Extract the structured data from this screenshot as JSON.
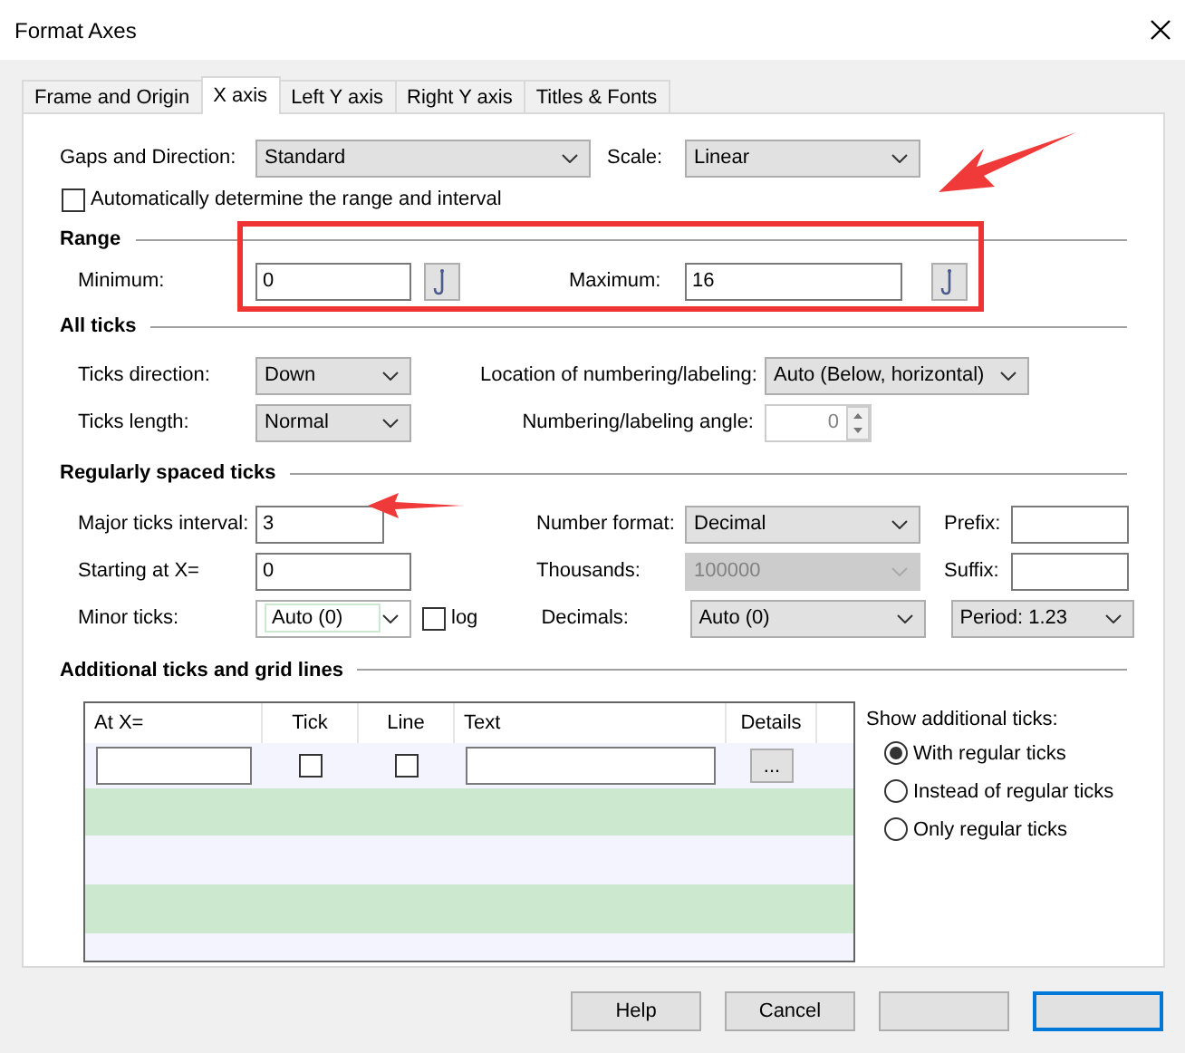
{
  "window": {
    "title": "Format Axes"
  },
  "tabs": [
    {
      "label": "Frame and Origin",
      "selected": false
    },
    {
      "label": "X axis",
      "selected": true
    },
    {
      "label": "Left Y axis",
      "selected": false
    },
    {
      "label": "Right Y axis",
      "selected": false
    },
    {
      "label": "Titles & Fonts",
      "selected": false
    }
  ],
  "gaps": {
    "label": "Gaps and Direction:",
    "value": "Standard"
  },
  "scale": {
    "label": "Scale:",
    "value": "Linear"
  },
  "auto_range": {
    "label": "Automatically determine the range and interval",
    "checked": false
  },
  "range": {
    "heading": "Range",
    "minimum": {
      "label": "Minimum:",
      "value": "0"
    },
    "maximum": {
      "label": "Maximum:",
      "value": "16"
    }
  },
  "all_ticks": {
    "heading": "All ticks",
    "direction": {
      "label": "Ticks direction:",
      "value": "Down"
    },
    "length": {
      "label": "Ticks length:",
      "value": "Normal"
    },
    "location": {
      "label": "Location of numbering/labeling:",
      "value": "Auto (Below, horizontal)"
    },
    "angle": {
      "label": "Numbering/labeling angle:",
      "value": "0",
      "disabled": true
    }
  },
  "regular": {
    "heading": "Regularly spaced ticks",
    "major": {
      "label": "Major ticks interval:",
      "value": "3"
    },
    "starting": {
      "label": "Starting at X=",
      "value": "0"
    },
    "minor": {
      "label": "Minor ticks:",
      "value": "Auto (0)"
    },
    "log": {
      "label": "log",
      "checked": false
    },
    "number_format": {
      "label": "Number format:",
      "value": "Decimal",
      "disabled": false
    },
    "thousands": {
      "label": "Thousands:",
      "value": "100000",
      "disabled": true
    },
    "decimals": {
      "label": "Decimals:",
      "value": "Auto (0)",
      "disabled": false
    },
    "prefix": {
      "label": "Prefix:"
    },
    "suffix": {
      "label": "Suffix:"
    },
    "period": {
      "value": "Period: 1.23"
    }
  },
  "additional": {
    "heading": "Additional ticks and grid lines",
    "columns": [
      "At X=",
      "Tick",
      "Line",
      "Text",
      "Details"
    ],
    "row": {
      "tick_checked": false,
      "line_checked": false,
      "details": "..."
    },
    "show": {
      "label": "Show additional ticks:",
      "options": [
        {
          "label": "With regular ticks",
          "selected": true
        },
        {
          "label": "Instead of regular ticks",
          "selected": false
        },
        {
          "label": "Only regular ticks",
          "selected": false
        }
      ]
    }
  },
  "buttons": [
    {
      "label": "Help",
      "default": false
    },
    {
      "label": "Cancel",
      "default": false
    },
    {
      "default": false
    },
    {
      "default": true
    }
  ]
}
